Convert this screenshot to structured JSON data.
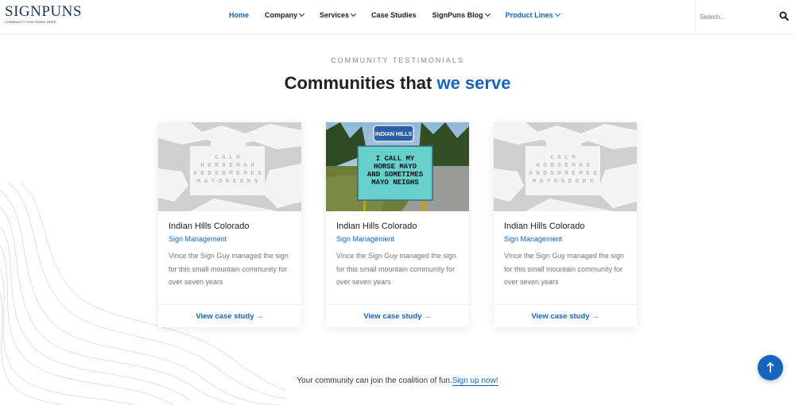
{
  "brand": {
    "name": "SIGNPUNS",
    "tagline": "COMMUNITY FUN SIGNS HERE"
  },
  "nav": {
    "items": [
      {
        "label": "Home",
        "dropdown": false,
        "style": "active"
      },
      {
        "label": "Company",
        "dropdown": true,
        "style": ""
      },
      {
        "label": "Services",
        "dropdown": true,
        "style": ""
      },
      {
        "label": "Case Studies",
        "dropdown": false,
        "style": ""
      },
      {
        "label": "SignPuns Blog",
        "dropdown": true,
        "style": ""
      },
      {
        "label": "Product Lines",
        "dropdown": true,
        "style": "accent"
      }
    ]
  },
  "search": {
    "placeholder": "Search..."
  },
  "section": {
    "eyebrow": "COMMUNITY TESTIMONIALS",
    "title_main": "Communities that ",
    "title_highlight": "we serve"
  },
  "cards": [
    {
      "image": "placeholder-sign",
      "sign_lines": [
        "C A L M",
        "H O R S E  M A  0",
        "A N D  S O M E  M E S",
        "M A Y 0  N E G H S"
      ],
      "title": "Indian Hills Colorado",
      "category": "Sign Management",
      "description": "Vince the Sign Guy managed the sign for this small mountain community for over seven years",
      "link": "View case study →"
    },
    {
      "image": "photo-sign",
      "banner": "INDIAN HILLS",
      "sign_lines": [
        "I CALL MY",
        "HORSE MAYO",
        "AND SOMETIMES",
        "MAYO NEIGHS"
      ],
      "title": "Indian Hills Colorado",
      "category": "Sign Management",
      "description": "Vince the Sign Guy managed the sign for this small mountain community for over seven years",
      "link": "View case study →"
    },
    {
      "image": "placeholder-sign",
      "sign_lines": [
        "C A L M",
        "H O R S E  M A  0",
        "A N D  S O M E  M E S",
        "M A Y 0  N E G H S"
      ],
      "title": "Indian Hills Colorado",
      "category": "Sign Management",
      "description": "Vince the Sign Guy managed the sign for this small mountain community for over seven years",
      "link": "View case study →"
    }
  ],
  "cta": {
    "text": "Your community can join the coalition of fun.",
    "link": "Sign up now!"
  },
  "colors": {
    "accent": "#1565c0",
    "text": "#222222",
    "muted": "#777777"
  },
  "icons": {
    "search": "search-icon",
    "back_to_top": "arrow-up-icon"
  }
}
